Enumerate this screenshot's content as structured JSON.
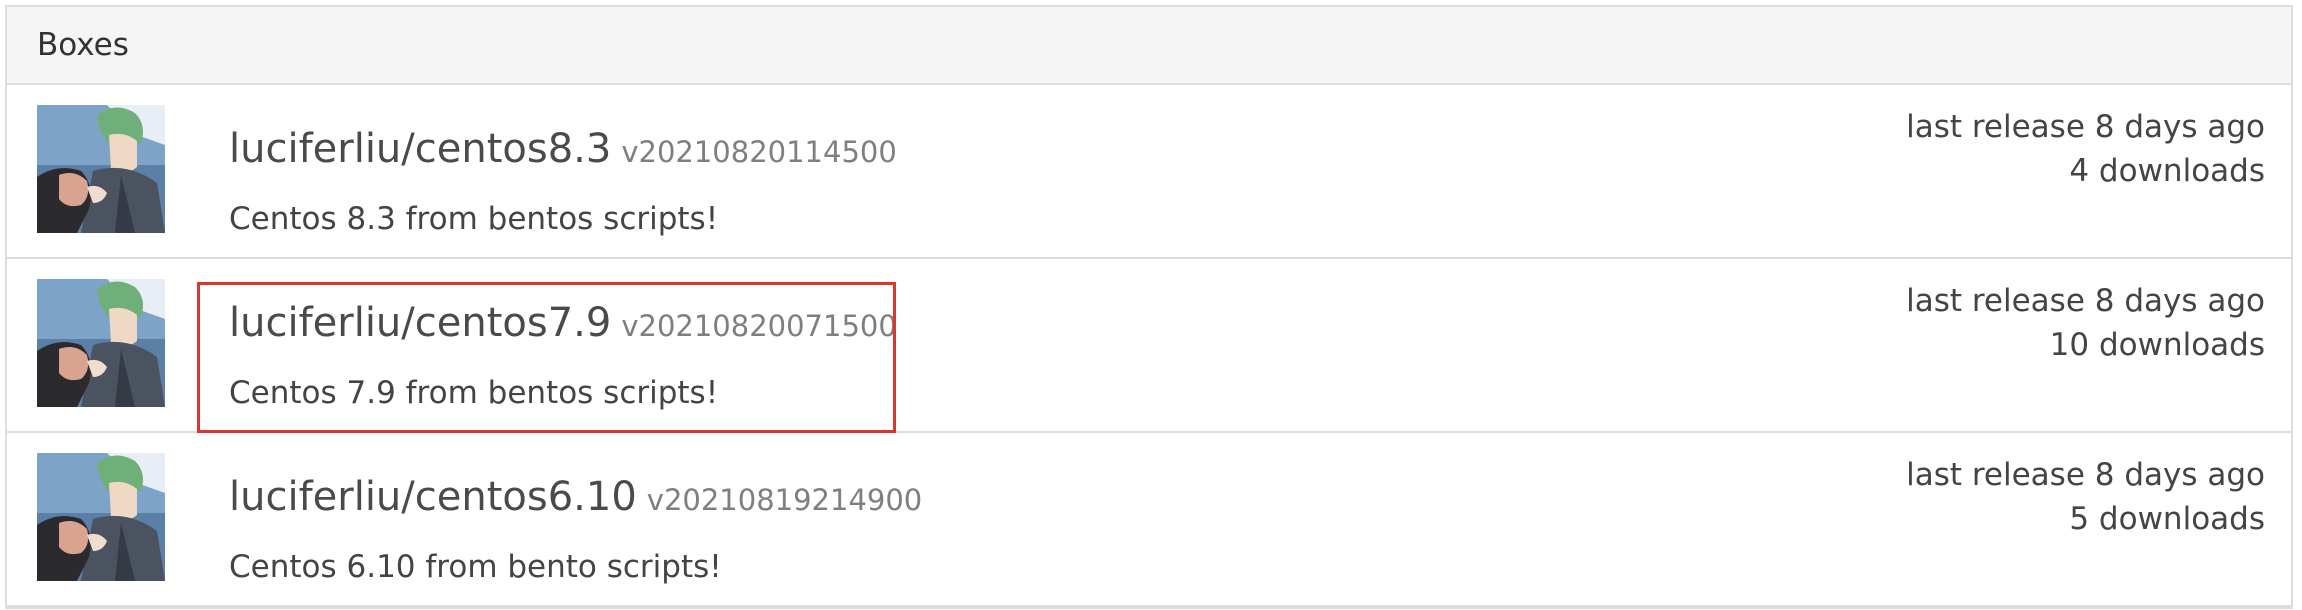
{
  "panel": {
    "title": "Boxes"
  },
  "boxes": [
    {
      "name": "luciferliu/centos8.3",
      "version": "v20210820114500",
      "description": "Centos 8.3 from bentos scripts!",
      "last_release": "last release 8 days ago",
      "downloads": "4 downloads",
      "avatar_icon": "user-avatar-icon"
    },
    {
      "name": "luciferliu/centos7.9",
      "version": "v20210820071500",
      "description": "Centos 7.9 from bentos scripts!",
      "last_release": "last release 8 days ago",
      "downloads": "10 downloads",
      "avatar_icon": "user-avatar-icon",
      "highlighted": true
    },
    {
      "name": "luciferliu/centos6.10",
      "version": "v20210819214900",
      "description": "Centos 6.10 from bento scripts!",
      "last_release": "last release 8 days ago",
      "downloads": "5 downloads",
      "avatar_icon": "user-avatar-icon"
    }
  ],
  "colors": {
    "highlight_border": "#d9362e",
    "heading_background": "#f5f5f5",
    "border": "#dddddd"
  }
}
